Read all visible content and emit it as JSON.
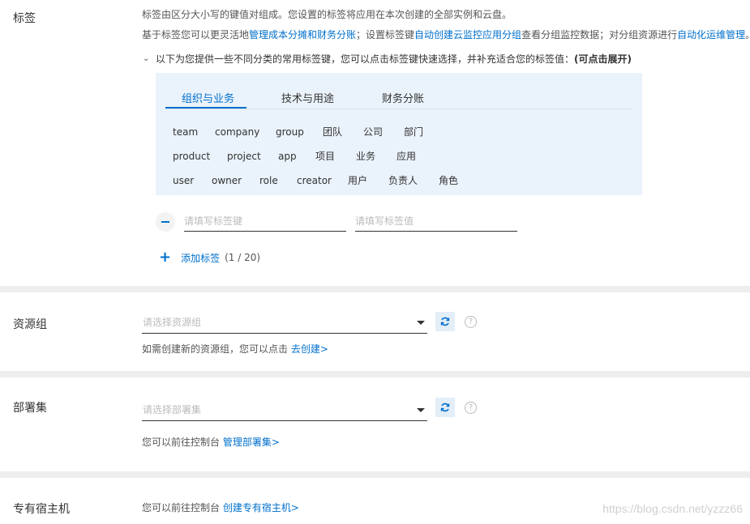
{
  "tags": {
    "label": "标签",
    "desc1": "标签由区分大小写的键值对组成。您设置的标签将应用在本次创建的全部实例和云盘。",
    "desc2_prefix": "基于标签您可以更灵活地",
    "desc2_link1": "管理成本分摊和财务分账",
    "desc2_mid": "；设置标签键",
    "desc2_link2": "自动创建云监控应用分组",
    "desc2_mid2": "查看分组监控数据；对分组资源进行",
    "desc2_link3": "自动化运维管理",
    "desc2_suffix": "。",
    "expand_text": "以下为您提供一些不同分类的常用标签键，您可以点击标签键快速选择，并补充适合您的标签值：",
    "expand_hint": "(可点击展开)",
    "tabs": [
      "组织与业务",
      "技术与用途",
      "财务分账"
    ],
    "rows": [
      [
        "team",
        "company",
        "group",
        "团队",
        "公司",
        "部门"
      ],
      [
        "product",
        "project",
        "app",
        "项目",
        "业务",
        "应用"
      ],
      [
        "user",
        "owner",
        "role",
        "creator",
        "用户",
        "负责人",
        "角色"
      ]
    ],
    "key_placeholder": "请填写标签键",
    "value_placeholder": "请填写标签值",
    "add_label": "添加标签",
    "count": "(1 / 20)"
  },
  "resource_group": {
    "label": "资源组",
    "placeholder": "请选择资源组",
    "hint": "如需创建新的资源组，您可以点击",
    "link": "去创建>"
  },
  "deployment_set": {
    "label": "部署集",
    "placeholder": "请选择部署集",
    "hint": "您可以前往控制台",
    "link": "管理部署集>"
  },
  "dedicated_host": {
    "label": "专有宿主机",
    "hint": "您可以前往控制台",
    "link": "创建专有宿主机>"
  },
  "watermark": "https://blog.csdn.net/yzzz66",
  "colors": {
    "accent": "#0070cc",
    "panel": "#eaf2fb",
    "divider": "#eeeeee"
  }
}
